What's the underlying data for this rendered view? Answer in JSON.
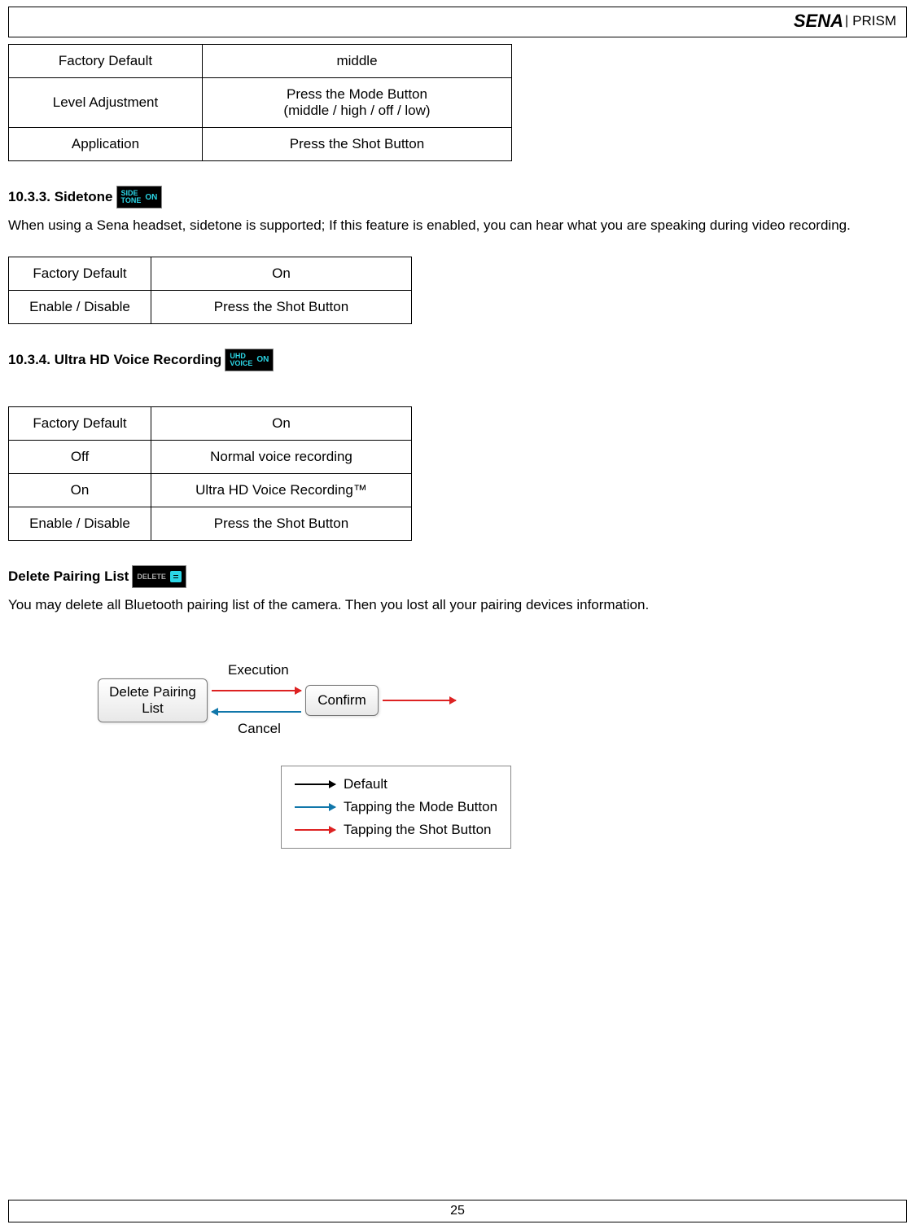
{
  "header": {
    "brand": "SENA",
    "sep": "|",
    "product": "PRISM"
  },
  "tables": {
    "t1": [
      {
        "k": "Factory Default",
        "v": "middle"
      },
      {
        "k": "Level Adjustment",
        "v": "Press the Mode Button\n(middle / high / off / low)"
      },
      {
        "k": "Application",
        "v": "Press the Shot Button"
      }
    ],
    "t2": [
      {
        "k": "Factory Default",
        "v": "On"
      },
      {
        "k": "Enable / Disable",
        "v": "Press the Shot Button"
      }
    ],
    "t3": [
      {
        "k": "Factory Default",
        "v": "On"
      },
      {
        "k": "Off",
        "v": "Normal voice recording"
      },
      {
        "k": "On",
        "v": "Ultra HD Voice Recording™"
      },
      {
        "k": "Enable / Disable",
        "v": "Press the Shot Button"
      }
    ]
  },
  "sections": {
    "sidetone": {
      "heading": "10.3.3. Sidetone",
      "icon_line1": "SIDE",
      "icon_line2": "TONE",
      "icon_on": "ON",
      "body": "When using a Sena headset, sidetone is supported; If this feature is enabled, you can hear what you are speaking during video recording."
    },
    "uhd": {
      "heading": "10.3.4. Ultra HD Voice Recording",
      "icon_line1": "UHD",
      "icon_line2": "VOICE",
      "icon_on": "ON"
    },
    "delete": {
      "heading": "Delete Pairing List",
      "icon_text": "DELETE",
      "body": "You may delete all Bluetooth pairing list of the camera. Then you lost all your pairing devices information."
    }
  },
  "diagram": {
    "box1_line1": "Delete Pairing",
    "box1_line2": "List",
    "box2": "Confirm",
    "label_execution": "Execution",
    "label_cancel": "Cancel",
    "legend_default": "Default",
    "legend_mode": "Tapping the Mode Button",
    "legend_shot": "Tapping the Shot Button"
  },
  "footer": {
    "page": "25"
  }
}
